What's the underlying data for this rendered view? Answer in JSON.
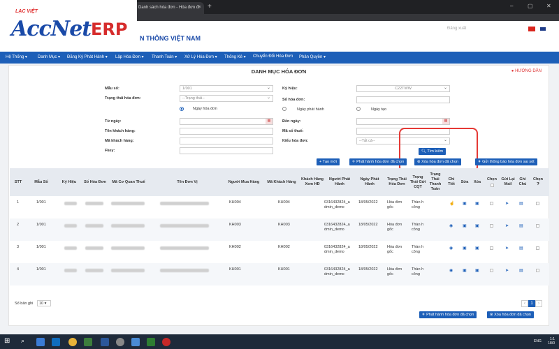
{
  "browser": {
    "tab_title": "Danh sách hóa đơn - Hóa đơn đi",
    "tab_close": "×",
    "new_tab": "+",
    "win_min": "–",
    "win_max": "▢",
    "win_close": "✕"
  },
  "brand": {
    "top": "LẠC VIỆT",
    "name": "AccNet",
    "suffix": "ERP",
    "company": "N THÔNG VIỆT NAM",
    "logout": "Đăng xuất"
  },
  "nav": [
    "Hệ Thống ▾",
    "Danh Mục ▾",
    "Đăng Ký Phát Hành ▾",
    "Lập Hóa Đơn ▾",
    "Thanh Toán ▾",
    "Xử Lý Hóa Đơn ▾",
    "Thống Kê ▾",
    "Chuyển Đổi Hóa Đơn",
    "Phân Quyền ▾"
  ],
  "page": {
    "title": "DANH MỤC HÓA ĐƠN",
    "help": "HƯỚNG DẪN"
  },
  "form": {
    "mau_so_label": "Mẫu số:",
    "mau_so_value": "1/001",
    "trang_thai_label": "Trạng thái hóa đơn:",
    "trang_thai_value": "--Trạng thái--",
    "ky_hieu_label": "Ký hiệu:",
    "ky_hieu_value": "C22TWW",
    "so_hd_label": "Số hóa đơn:",
    "radio_ngay_hd": "Ngày hóa đơn",
    "radio_ngay_ph": "Ngày phát hành",
    "radio_ngay_tao": "Ngày tạo",
    "tu_ngay_label": "Từ ngày:",
    "den_ngay_label": "Đến ngày:",
    "ten_kh_label": "Tên khách hàng:",
    "mst_label": "Mã số thuế:",
    "ma_kh_label": "Mã khách hàng:",
    "kieu_hd_label": "Kiểu hóa đơn:",
    "kieu_hd_value": "--Tất cả--",
    "fkey_label": "Fkey:",
    "search_btn": "Tìm kiếm"
  },
  "actions": {
    "create": "Tạo mới",
    "publish_selected": "Phát hành hóa đơn đã chọn",
    "delete_selected": "Xóa hóa đơn đã chọn",
    "send_error": "Gửi thông báo hóa đơn sai sót"
  },
  "table": {
    "headers": [
      "STT",
      "Mẫu Số",
      "Ký Hiệu",
      "Số Hóa Đơn",
      "Mã Cơ Quan Thuế",
      "Tên Đơn Vị",
      "Người Mua Hàng",
      "Mã Khách Hàng",
      "Khách Hàng Xem HĐ",
      "Người Phát Hành",
      "Ngày Phát Hành",
      "Trạng Thái Hóa Đơn",
      "Trạng Thái Gửi CQT",
      "Trạng Thái Thanh Toán",
      "Chi Tiết",
      "Sửa",
      "Xóa",
      "Chọn",
      "Gửi Lại Mail",
      "Ghi Chú",
      "Chọn"
    ],
    "rows": [
      {
        "stt": "1",
        "mau_so": "1/001",
        "nguoi_mua": "KH004",
        "ma_kh": "KH004",
        "nguoi_ph": "0316432824_a dmin_demo",
        "ngay_ph": "18/05/2022",
        "tt_hd": "Hóa đơn gốc",
        "tt_cqt": "Thàn h công"
      },
      {
        "stt": "2",
        "mau_so": "1/001",
        "nguoi_mua": "KH003",
        "ma_kh": "KH003",
        "nguoi_ph": "0316432824_a dmin_demo",
        "ngay_ph": "18/05/2022",
        "tt_hd": "Hóa đơn gốc",
        "tt_cqt": "Thàn h công"
      },
      {
        "stt": "3",
        "mau_so": "1/001",
        "nguoi_mua": "KH002",
        "ma_kh": "KH002",
        "nguoi_ph": "0316432824_a dmin_demo",
        "ngay_ph": "18/05/2022",
        "tt_hd": "Hóa đơn gốc",
        "tt_cqt": "Thàn h công"
      },
      {
        "stt": "4",
        "mau_so": "1/001",
        "nguoi_mua": "KH001",
        "ma_kh": "KH001",
        "nguoi_ph": "0316432824_a dmin_demo",
        "ngay_ph": "18/05/2022",
        "tt_hd": "Hóa đơn gốc",
        "tt_cqt": "Thàn h công"
      }
    ]
  },
  "footer": {
    "page_size_label": "Số bản ghi",
    "page_size": "10 ▾",
    "page_prev": "‹",
    "page_current": "1",
    "page_next": "›",
    "publish_selected": "Phát hành hóa đơn đã chọn",
    "delete_selected": "Xóa hóa đơn đã chọn"
  },
  "taskbar": {
    "lang": "ENG",
    "time": "1:1",
    "date": "18/0"
  },
  "colors": {
    "nav_blue": "#1d5fb8",
    "highlight_red": "#e53935",
    "brand_red": "#d62c2c"
  }
}
